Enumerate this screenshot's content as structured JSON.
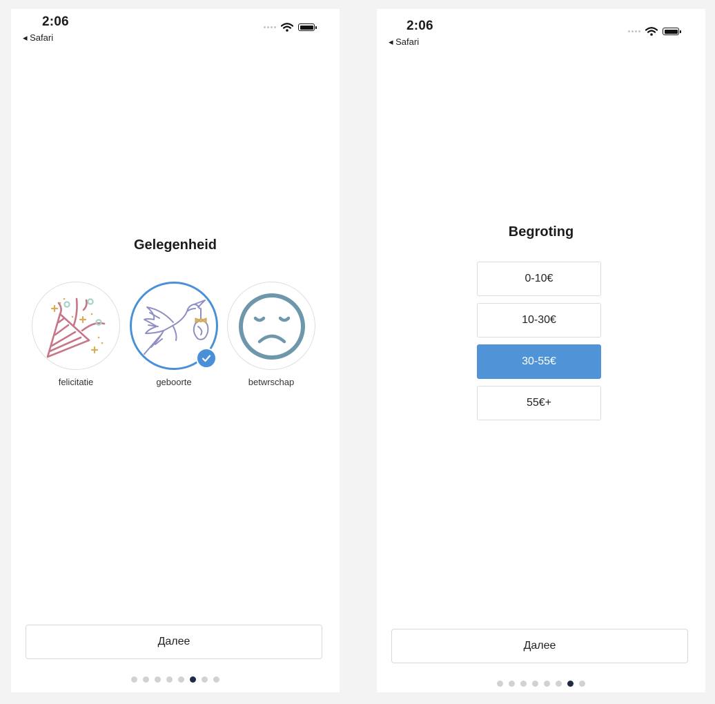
{
  "screens": [
    {
      "status": {
        "time": "2:06",
        "back_label": "◂ Safari"
      },
      "title": "Gelegenheid",
      "occasions": [
        {
          "label": "felicitatie",
          "icon": "party-popper-icon",
          "selected": false
        },
        {
          "label": "geboorte",
          "icon": "stork-icon",
          "selected": true
        },
        {
          "label": "betwrschap",
          "icon": "sad-face-icon",
          "selected": false
        }
      ],
      "next_label": "Далее",
      "pager": {
        "count": 8,
        "active_index": 5
      }
    },
    {
      "status": {
        "time": "2:06",
        "back_label": "◂ Safari"
      },
      "title": "Begroting",
      "budget_options": [
        {
          "label": "0-10€",
          "selected": false
        },
        {
          "label": "10-30€",
          "selected": false
        },
        {
          "label": "30-55€",
          "selected": true
        },
        {
          "label": "55€+",
          "selected": false
        }
      ],
      "next_label": "Далее",
      "pager": {
        "count": 8,
        "active_index": 6
      }
    }
  ],
  "colors": {
    "accent": "#4a90d9",
    "selected_fill": "#5094d7",
    "dot_active": "#1f2a44",
    "dot_inactive": "#d2d2d2"
  }
}
